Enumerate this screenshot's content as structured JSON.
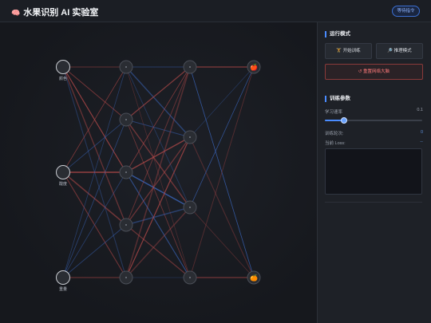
{
  "header": {
    "icon": "brain-icon",
    "title": "水果识别 AI 实验室",
    "status": "等待指令"
  },
  "network": {
    "layers": [
      3,
      5,
      5,
      2
    ],
    "input_labels": [
      "颜色",
      "酸度",
      "重量"
    ],
    "output_icons": [
      "apple-icon",
      "orange-icon"
    ],
    "output_glyphs": [
      "🍎",
      "🍊"
    ],
    "colors": {
      "positive": "#3a64b8",
      "negative": "#b04848",
      "node_fill": "#2a2d33",
      "node_stroke": "#4a4e57",
      "input_stroke": "#c9ccd2"
    }
  },
  "panel": {
    "mode_title": "运行模式",
    "train_label": "🏋 开始训练",
    "infer_label": "🔎 推理模式",
    "reset_label": "↺ 重置网络大脑",
    "params_title": "训练参数",
    "lr_label": "学习速率",
    "lr_value": "0.1",
    "lr_fraction": 0.2,
    "epochs_label": "训练轮次:",
    "epochs_value": "0",
    "loss_label": "当前 Loss:",
    "loss_value": "--"
  }
}
